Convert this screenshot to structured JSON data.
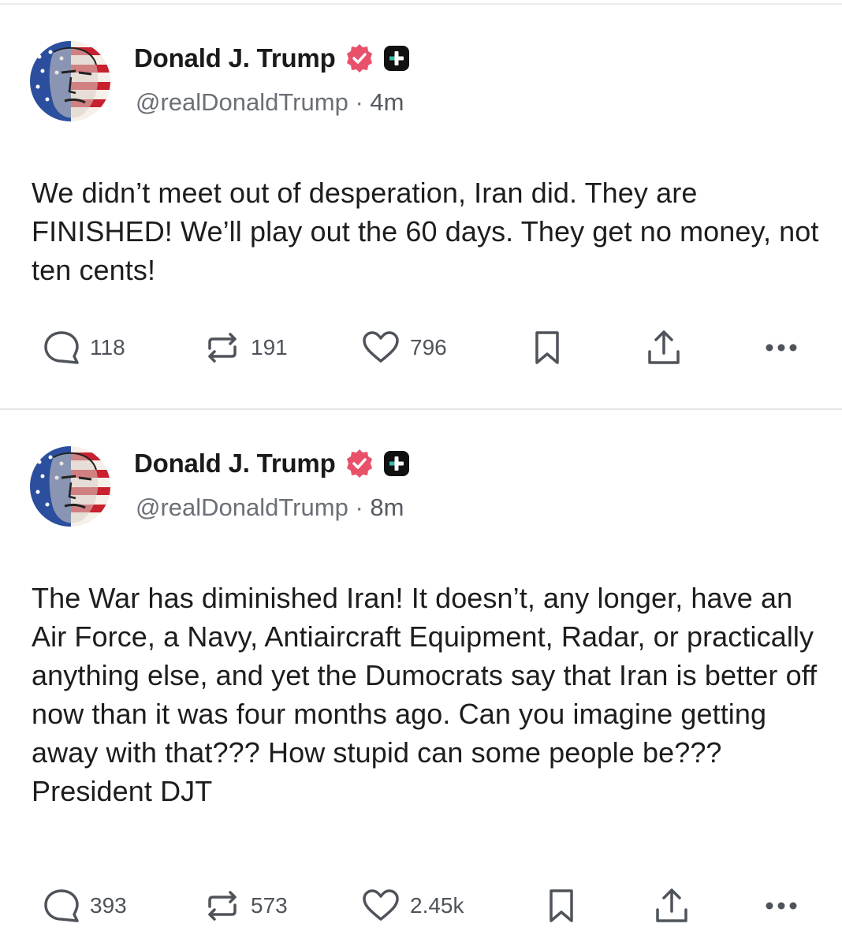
{
  "colors": {
    "verified_badge": "#e9516a",
    "plus_badge": "#111111",
    "text": "#1d1d1d",
    "muted": "#6b6f76"
  },
  "icons": {
    "reply": "comment-bubble-icon",
    "repost": "repost-arrows-icon",
    "like": "heart-icon",
    "bookmark": "bookmark-icon",
    "share": "share-upload-icon",
    "more": "ellipsis-icon",
    "verified": "verified-badge-icon",
    "plus": "plus-badge-icon"
  },
  "posts": [
    {
      "author_name": "Donald J. Trump",
      "handle": "@realDonaldTrump",
      "separator": "·",
      "time": "4m",
      "text": "We didn’t meet out of desperation, Iran did. They are FINISHED! We’ll play out the 60 days. They get no money, not ten cents!",
      "replies": "118",
      "reposts": "191",
      "likes": "796"
    },
    {
      "author_name": "Donald J. Trump",
      "handle": "@realDonaldTrump",
      "separator": "·",
      "time": "8m",
      "text": "The War has diminished Iran! It doesn’t, any longer, have an Air Force, a Navy, Antiaircraft Equipment, Radar, or practically anything else, and yet the Dumocrats say that Iran is better off now than it was four months ago. Can you imagine getting away with that??? How stupid can some people be??? President DJT",
      "replies": "393",
      "reposts": "573",
      "likes": "2.45k"
    }
  ]
}
